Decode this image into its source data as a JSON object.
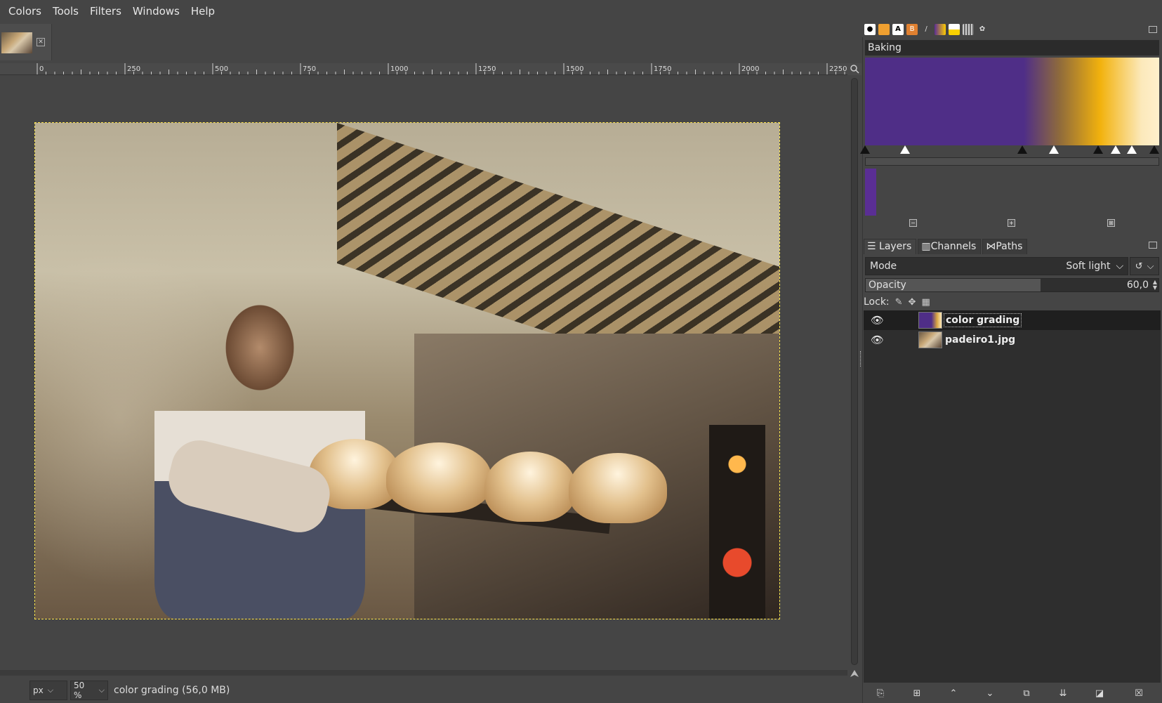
{
  "menubar": {
    "items": [
      "Colors",
      "Tools",
      "Filters",
      "Windows",
      "Help"
    ]
  },
  "ruler": {
    "labels": [
      "0",
      "250",
      "500",
      "750",
      "1000",
      "1250",
      "1500",
      "1750",
      "2000",
      "2250"
    ]
  },
  "statusbar": {
    "unit": "px",
    "zoom": "50 %",
    "message": "color grading (56,0 MB)"
  },
  "gradient_editor": {
    "name": "Baking",
    "colors": {
      "start": "#4f2e87",
      "middle": "#f2b20d",
      "end": "#fff0cc"
    }
  },
  "layers_panel": {
    "tabs": [
      "Layers",
      "Channels",
      "Paths"
    ],
    "mode_label": "Mode",
    "mode_value": "Soft light",
    "opacity_label": "Opacity",
    "opacity_value": "60,0",
    "opacity_fraction": 0.6,
    "lock_label": "Lock:",
    "layers": [
      {
        "name": "color grading",
        "visible": true,
        "selected": true
      },
      {
        "name": "padeiro1.jpg",
        "visible": true,
        "selected": false
      }
    ]
  },
  "icons": {
    "menu": "dock-menu-icon",
    "eye": "eye-icon",
    "new_layer": "new-layer-icon",
    "new_group": "new-group-icon",
    "raise": "raise-layer-icon",
    "lower": "lower-layer-icon",
    "duplicate": "duplicate-layer-icon",
    "merge": "merge-layer-icon",
    "mask": "layer-mask-icon",
    "delete": "delete-layer-icon"
  }
}
